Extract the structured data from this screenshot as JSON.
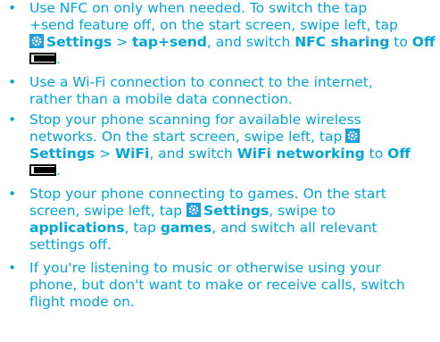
{
  "items": [
    {
      "lines": [
        [
          "Use NFC on only when needed. To switch the tap"
        ],
        [
          "+send feature off, on the start screen, swipe left, tap"
        ],
        [
          "Settings",
          " > ",
          "tap+send",
          ", and switch ",
          "NFC sharing",
          " to ",
          "Off"
        ],
        [
          "."
        ]
      ]
    },
    {
      "lines": [
        [
          "Use a Wi-Fi connection to connect to the internet,"
        ],
        [
          "rather than a mobile data connection."
        ]
      ]
    },
    {
      "lines": [
        [
          "Stop your phone scanning for available wireless"
        ],
        [
          "networks. On the start screen, swipe left, tap"
        ],
        [
          "Settings",
          " > ",
          "WiFi",
          ", and switch ",
          "WiFi networking",
          " to ",
          "Off"
        ],
        [
          "."
        ]
      ]
    },
    {
      "lines": [
        [
          "Stop your phone connecting to games. On the start"
        ],
        [
          "screen, swipe left, tap ",
          "Settings",
          ", swipe to"
        ],
        [
          "applications",
          ", tap ",
          "games",
          ", and switch all relevant"
        ],
        [
          "settings off."
        ]
      ]
    },
    {
      "lines": [
        [
          "If you're listening to music or otherwise using your"
        ],
        [
          "phone, but don't want to make or receive calls, switch"
        ],
        [
          "flight mode on."
        ]
      ]
    }
  ],
  "bullet": "•",
  "icons": {
    "settings": "settings-gear-icon",
    "toggle": "toggle-off-icon"
  },
  "colors": {
    "text": "#00a6d8",
    "icon_bg": "#1c9fe0"
  }
}
